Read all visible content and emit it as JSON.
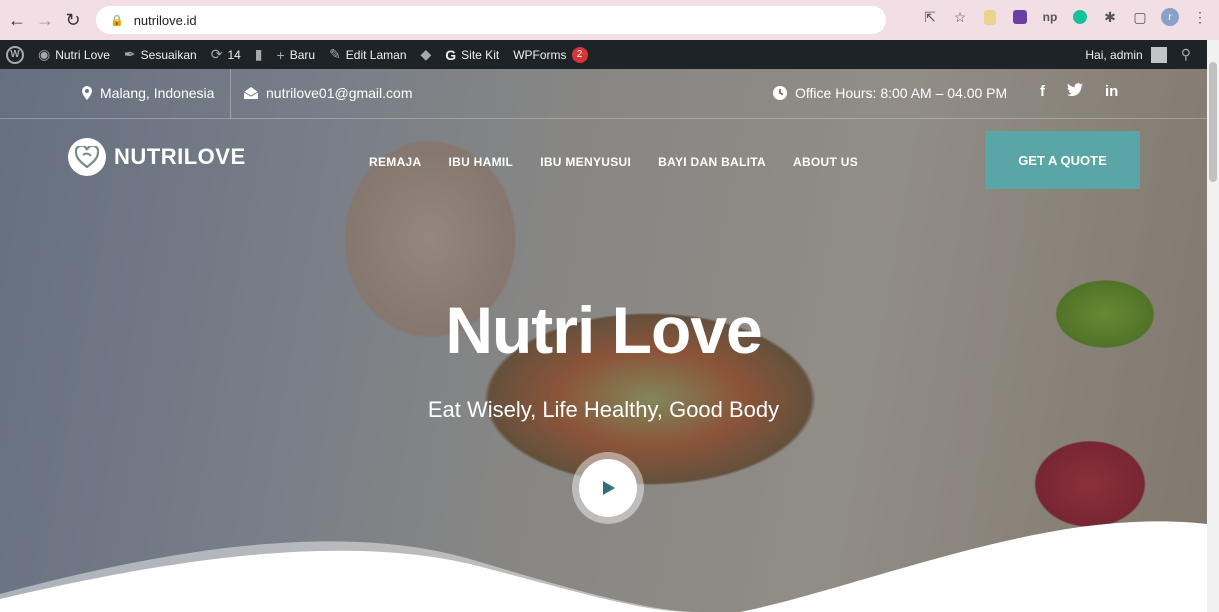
{
  "browser": {
    "url": "nutrilove.id",
    "profile_initial": "r"
  },
  "admin_bar": {
    "site_name": "Nutri Love",
    "customize": "Sesuaikan",
    "updates_count": "14",
    "new": "Baru",
    "edit_page": "Edit Laman",
    "site_kit": "Site Kit",
    "wpforms": "WPForms",
    "wpforms_badge": "2",
    "greeting": "Hai, admin"
  },
  "top_info": {
    "location": "Malang, Indonesia",
    "email": "nutrilove01@gmail.com",
    "hours": "Office Hours: 8:00 AM – 04.00 PM",
    "social": [
      "f",
      "t",
      "in"
    ]
  },
  "header": {
    "logo_text": "NUTRILOVE",
    "menu": [
      "REMAJA",
      "IBU HAMIL",
      "IBU MENYUSUI",
      "BAYI DAN BALITA",
      "ABOUT US"
    ],
    "cta": "GET A QUOTE"
  },
  "hero": {
    "title": "Nutri Love",
    "subtitle": "Eat Wisely, Life Healthy, Good Body"
  },
  "colors": {
    "accent": "#5aa5a6",
    "admin_bar": "#1d2327",
    "chrome": "#f2dfe6",
    "badge": "#d63638"
  }
}
